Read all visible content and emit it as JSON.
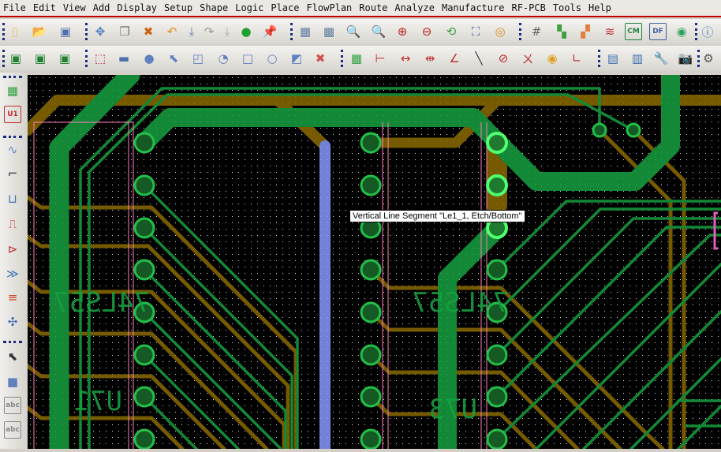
{
  "menu": [
    "File",
    "Edit",
    "View",
    "Add",
    "Display",
    "Setup",
    "Shape",
    "Logic",
    "Place",
    "FlowPlan",
    "Route",
    "Analyze",
    "Manufacture",
    "RF-PCB",
    "Tools",
    "Help"
  ],
  "toolbar1": [
    {
      "name": "new-file-icon",
      "g": "▯",
      "c": "#e8c070"
    },
    {
      "name": "open-folder-icon",
      "g": "📂",
      "c": "#d0a050"
    },
    {
      "name": "save-icon",
      "g": "▣",
      "c": "#5070b0"
    },
    {
      "name": "move-icon",
      "g": "✥",
      "c": "#5080c0"
    },
    {
      "name": "copy-icon",
      "g": "❐",
      "c": "#777"
    },
    {
      "name": "delete-icon",
      "g": "✖",
      "c": "#d06010"
    },
    {
      "name": "undo-icon",
      "g": "↶",
      "c": "#e09020"
    },
    {
      "name": "down-arrow-icon",
      "g": "⤓",
      "c": "#6080b0"
    },
    {
      "name": "redo-icon",
      "g": "↷",
      "c": "#999"
    },
    {
      "name": "down-arrow-disabled-icon",
      "g": "⤓",
      "c": "#aaa"
    },
    {
      "name": "green-ball-icon",
      "g": "●",
      "c": "#20a030"
    },
    {
      "name": "pin-icon",
      "g": "📌",
      "c": "#20a030"
    },
    {
      "name": "grid-display-icon",
      "g": "▦",
      "c": "#6080a0"
    },
    {
      "name": "mesh-icon",
      "g": "▩",
      "c": "#6080a0"
    },
    {
      "name": "zoom-by-points-icon",
      "g": "🔍",
      "c": "#4060a0"
    },
    {
      "name": "zoom-world-icon",
      "g": "🔍",
      "c": "#c05080"
    },
    {
      "name": "zoom-in-icon",
      "g": "⊕",
      "c": "#c02020"
    },
    {
      "name": "zoom-out-icon",
      "g": "⊖",
      "c": "#c02020"
    },
    {
      "name": "zoom-previous-icon",
      "g": "⟲",
      "c": "#30a040"
    },
    {
      "name": "zoom-fit-icon",
      "g": "⛶",
      "c": "#4060a0"
    },
    {
      "name": "redraw-icon",
      "g": "◎",
      "c": "#e09020"
    },
    {
      "name": "grid-icon",
      "g": "#",
      "c": "#666"
    },
    {
      "name": "color-icon",
      "g": "▚",
      "c": "#40a040"
    },
    {
      "name": "assign-color-icon",
      "g": "▞",
      "c": "#e08040"
    },
    {
      "name": "layers-icon",
      "g": "≋",
      "c": "#c03030"
    },
    {
      "name": "constraint-manager-icon",
      "g": "CM",
      "c": "#208040"
    },
    {
      "name": "dfa-icon",
      "g": "DF",
      "c": "#4060a0"
    },
    {
      "name": "3d-view-icon",
      "g": "◉",
      "c": "#30a060"
    },
    {
      "name": "info-icon",
      "g": "ⓘ",
      "c": "#4080c0"
    }
  ],
  "toolbar1_x": [
    19,
    50,
    83,
    127,
    158,
    188,
    218,
    243,
    265,
    288,
    312,
    342,
    387,
    417,
    448,
    480,
    510,
    541,
    572,
    603,
    634,
    680,
    712,
    742,
    773,
    803,
    834,
    864,
    897
  ],
  "toolbar2": [
    {
      "name": "placement-mode-icon",
      "g": "▣",
      "c": "#208030"
    },
    {
      "name": "etch-edit-icon",
      "g": "▣",
      "c": "#208030"
    },
    {
      "name": "route-mode-icon",
      "g": "▣",
      "c": "#208030"
    },
    {
      "name": "select-shape-icon",
      "g": "⬚",
      "c": "#c03040"
    },
    {
      "name": "select-area-icon",
      "g": "▬",
      "c": "#5070b0"
    },
    {
      "name": "circle-shape-icon",
      "g": "●",
      "c": "#6080c0"
    },
    {
      "name": "pointer-select-icon",
      "g": "⬉",
      "c": "#6080c0"
    },
    {
      "name": "rect-shape-icon",
      "g": "◰",
      "c": "#6080c0"
    },
    {
      "name": "arc-shape-icon",
      "g": "◔",
      "c": "#6080c0"
    },
    {
      "name": "square-shape-icon",
      "g": "□",
      "c": "#6080c0"
    },
    {
      "name": "circle-outline-icon",
      "g": "○",
      "c": "#6080c0"
    },
    {
      "name": "void-shape-icon",
      "g": "◩",
      "c": "#6080c0"
    },
    {
      "name": "delete-shape-icon",
      "g": "✖",
      "c": "#d05050"
    },
    {
      "name": "component-icon",
      "g": "▦",
      "c": "#30a040"
    },
    {
      "name": "dimension-edge-icon",
      "g": "⊢",
      "c": "#c03030"
    },
    {
      "name": "linear-dimension-icon",
      "g": "↔",
      "c": "#c03030"
    },
    {
      "name": "datum-dimension-icon",
      "g": "⇹",
      "c": "#c03030"
    },
    {
      "name": "angular-dimension-icon",
      "g": "∠",
      "c": "#c03030"
    },
    {
      "name": "line-icon",
      "g": "╲",
      "c": "#333"
    },
    {
      "name": "radius-dimension-icon",
      "g": "⊘",
      "c": "#c03030"
    },
    {
      "name": "chamfer-icon",
      "g": "ㄨ",
      "c": "#c03030"
    },
    {
      "name": "leader-icon",
      "g": "◉",
      "c": "#e0a020"
    },
    {
      "name": "angle-icon",
      "g": "∟",
      "c": "#c03030"
    },
    {
      "name": "odb-export-icon",
      "g": "▤",
      "c": "#4070b0"
    },
    {
      "name": "library-icon",
      "g": "▥",
      "c": "#4070b0"
    },
    {
      "name": "tools-icon",
      "g": "🔧",
      "c": "#777"
    },
    {
      "name": "camera-icon",
      "g": "📷",
      "c": "#555"
    },
    {
      "name": "rename-refdes-icon",
      "g": "⚙",
      "c": "#555"
    }
  ],
  "toolbar2_x": [
    20,
    51,
    82,
    127,
    157,
    189,
    220,
    251,
    283,
    314,
    345,
    376,
    406,
    452,
    482,
    514,
    545,
    576,
    607,
    638,
    669,
    700,
    731,
    777,
    808,
    838,
    869,
    898
  ],
  "lefttoolbar": [
    {
      "name": "place-manual-icon",
      "g": "▦",
      "c": "#30a040"
    },
    {
      "name": "component-u1-icon",
      "g": "U1",
      "c": "#c03030"
    },
    {
      "name": "add-connect-icon",
      "g": "∿",
      "c": "#6080c0"
    },
    {
      "name": "slide-icon",
      "g": "⌐",
      "c": "#333"
    },
    {
      "name": "delay-tune-icon",
      "g": "⊔",
      "c": "#4070b0"
    },
    {
      "name": "phase-tune-icon",
      "g": "⎍",
      "c": "#c03030"
    },
    {
      "name": "fanout-icon",
      "g": "⊳",
      "c": "#c03030"
    },
    {
      "name": "spread-icon",
      "g": "≫",
      "c": "#4070b0"
    },
    {
      "name": "bus-route-icon",
      "g": "≡",
      "c": "#d04020"
    },
    {
      "name": "auto-route-icon",
      "g": "✣",
      "c": "#4070b0"
    },
    {
      "name": "select-pointer-icon",
      "g": "⬉",
      "c": "#333"
    },
    {
      "name": "rectangle-icon",
      "g": "■",
      "c": "#6080c0"
    },
    {
      "name": "add-text-icon",
      "g": "abc",
      "c": "#888"
    },
    {
      "name": "edit-text-icon",
      "g": "abc",
      "c": "#888"
    }
  ],
  "lefttoolbar_y": [
    115,
    145,
    190,
    220,
    252,
    284,
    316,
    347,
    377,
    408,
    452,
    484,
    514,
    545
  ],
  "board": {
    "u71_value": "74LS57",
    "u71_refdes": "U71",
    "u73_value": "74LS57",
    "u73_refdes": "U73"
  },
  "tooltip": "Vertical Line Segment \"Le1_1, Etch/Bottom\"",
  "colors": {
    "etch_top": "#17a040",
    "etch_bottom": "#8a6a00",
    "highlight": "#8899ff",
    "outline": "#ff80c0"
  }
}
